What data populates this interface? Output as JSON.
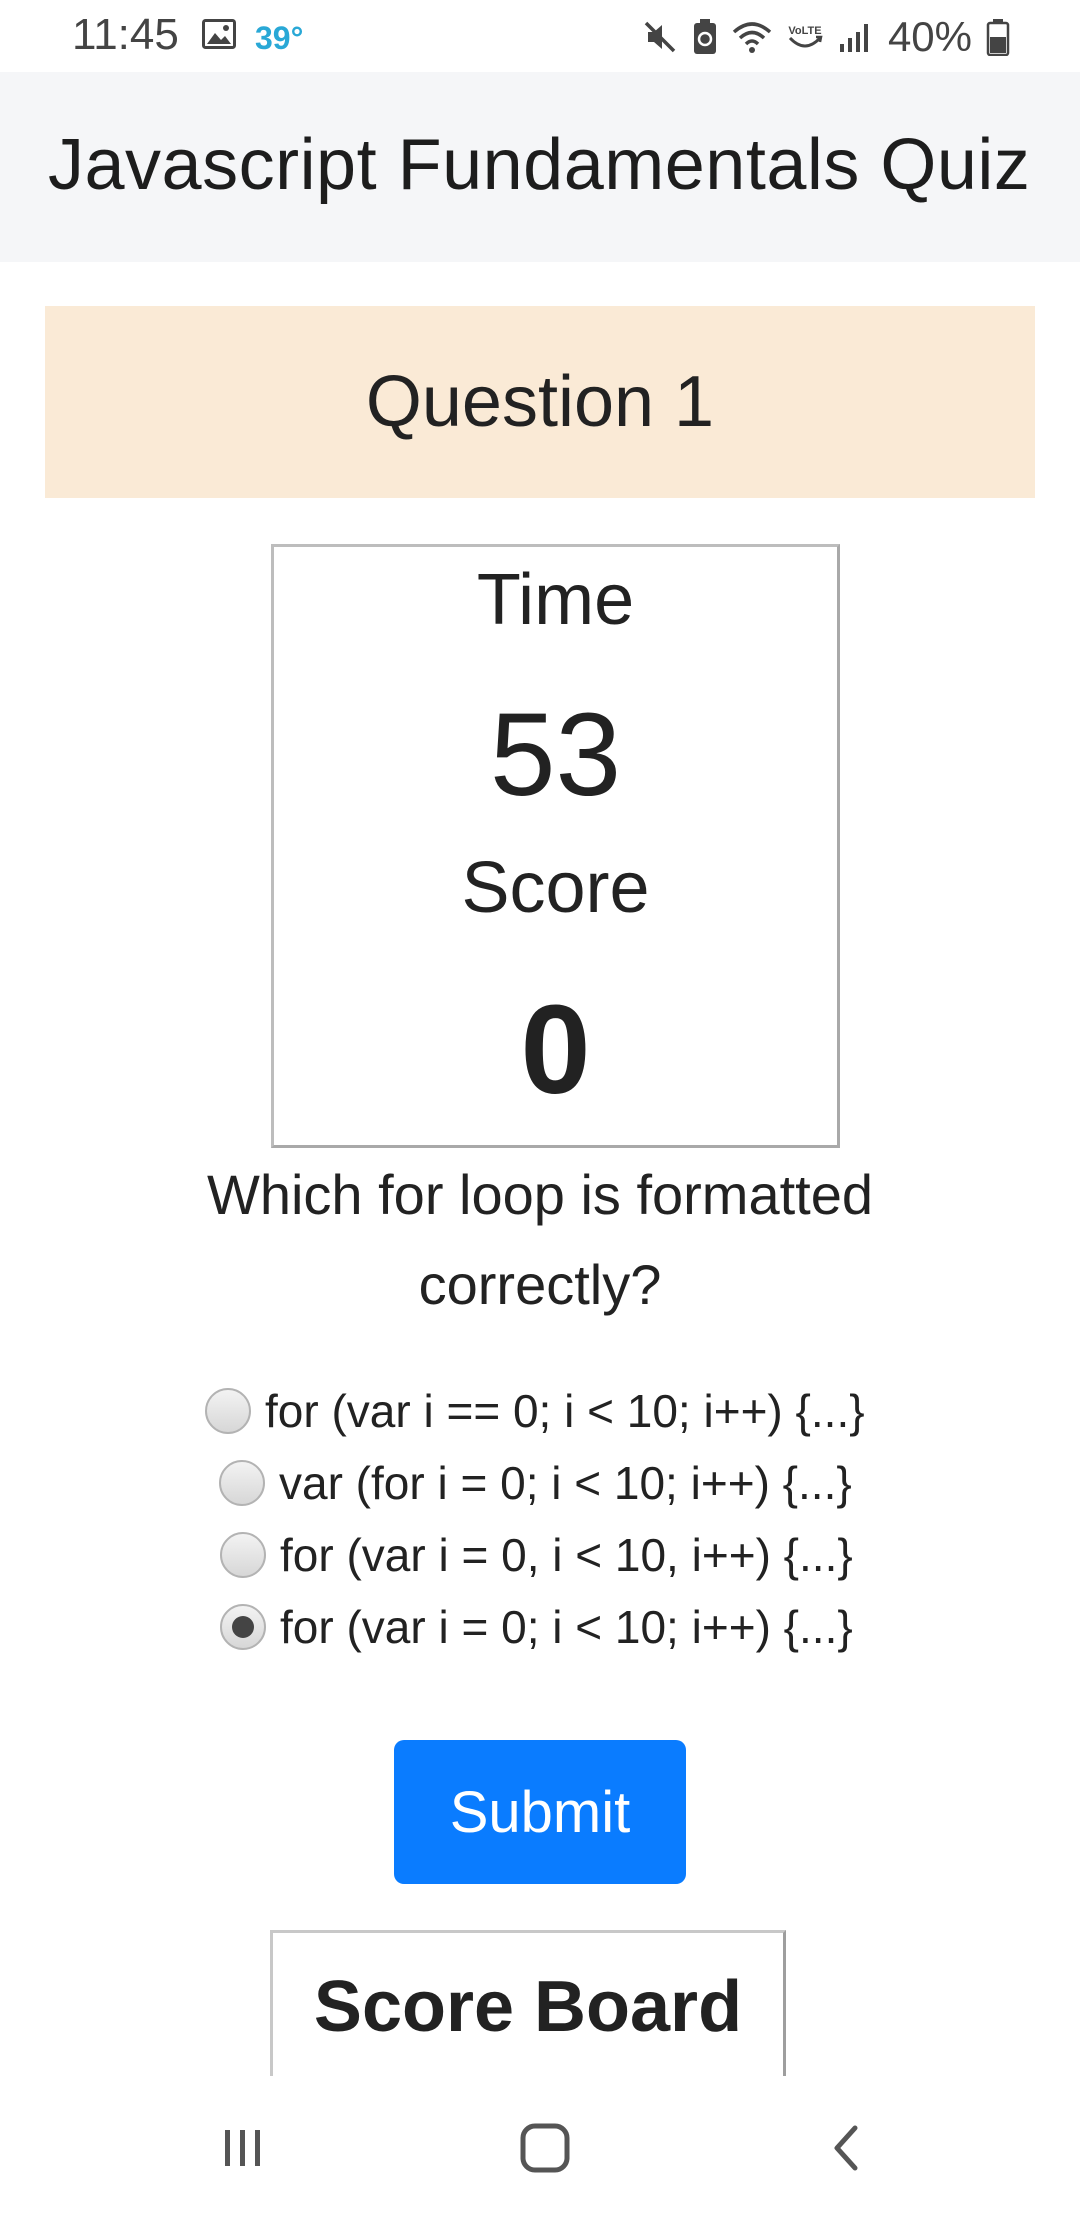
{
  "status_bar": {
    "time": "11:45",
    "temperature": "39°",
    "battery": "40%",
    "icons": [
      "gallery-icon",
      "mute-icon",
      "battery-saver-icon",
      "wifi-icon",
      "volte-icon",
      "signal-icon",
      "battery-icon"
    ]
  },
  "header": {
    "title": "Javascript Fundamentals Quiz"
  },
  "question_banner": {
    "label": "Question 1"
  },
  "stats": {
    "time_label": "Time",
    "time_value": "53",
    "score_label": "Score",
    "score_value": "0"
  },
  "question": {
    "text": "Which for loop is formatted correctly?",
    "options": [
      {
        "label": "for (var i == 0; i < 10; i++) {...}",
        "checked": false
      },
      {
        "label": "var (for i = 0; i < 10; i++) {...}",
        "checked": false
      },
      {
        "label": "for (var i = 0, i < 10, i++) {...}",
        "checked": false
      },
      {
        "label": "for (var i = 0; i < 10; i++) {...}",
        "checked": true
      }
    ]
  },
  "submit": {
    "label": "Submit"
  },
  "scoreboard": {
    "title": "Score Board"
  },
  "nav_bar": {
    "buttons": [
      "recent-apps-icon",
      "home-icon",
      "back-icon"
    ]
  },
  "colors": {
    "accent": "#0a7cff",
    "banner": "#faead6",
    "header_bg": "#f5f6f8",
    "temperature": "#29a8d6"
  }
}
